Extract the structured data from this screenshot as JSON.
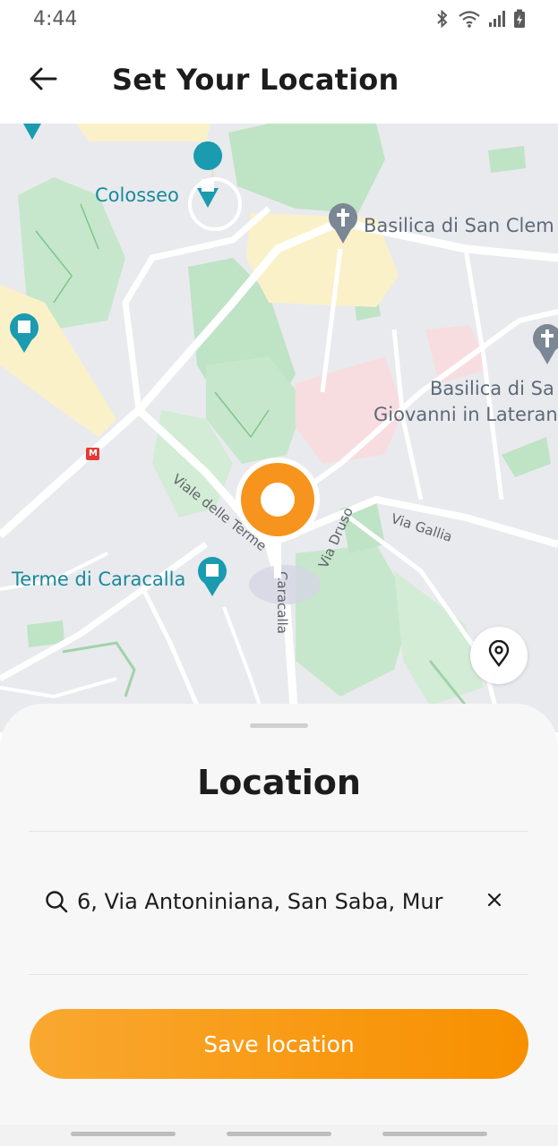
{
  "status_bar": {
    "time": "4:44",
    "icons": [
      "bluetooth-icon",
      "wifi-icon",
      "signal-icon",
      "battery-charging-icon"
    ]
  },
  "header": {
    "title": "Set Your Location",
    "back_icon": "arrow-left-icon"
  },
  "map": {
    "labels": {
      "colosseo": "Colosseo",
      "basilica_clemente": "Basilica di San Clem",
      "basilica_sa": "Basilica di Sa",
      "giovanni": "Giovanni in Laterano",
      "terme": "Terme di Caracalla",
      "via_gallia": "Via Gallia",
      "via_druso": "Via Druso",
      "viale_terme": "Viale delle Terme",
      "caracalla": "Caracalla",
      "metro": "M"
    },
    "pin_color": "#f7941d",
    "locate_icon": "location-pin-icon"
  },
  "sheet": {
    "title": "Location",
    "search": {
      "value": "6, Via Antoniniana, San Saba, Mur",
      "icon": "search-icon",
      "clear_icon": "close-icon"
    },
    "save_label": "Save location"
  },
  "colors": {
    "accent": "#f99a14",
    "map_bg": "#e9eaee",
    "park": "#bfe3c5",
    "poi_teal": "#178a9b"
  }
}
